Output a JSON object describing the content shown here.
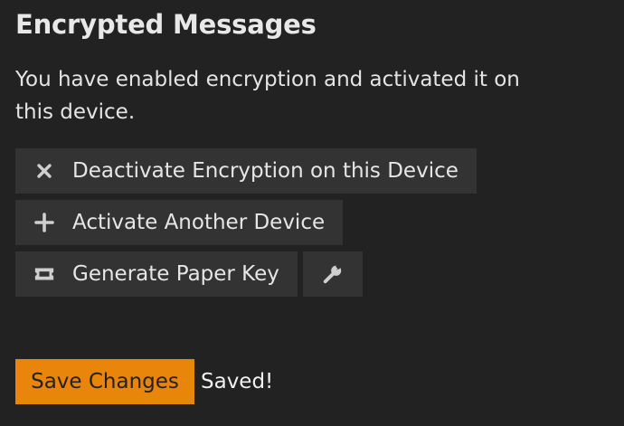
{
  "section": {
    "title": "Encrypted Messages",
    "description": "You have enabled encryption and activated it on this device."
  },
  "actions": {
    "deactivate": {
      "label": "Deactivate Encryption on this Device",
      "icon": "close-icon"
    },
    "activate_another": {
      "label": "Activate Another Device",
      "icon": "plus-icon"
    },
    "paper_key": {
      "label": "Generate Paper Key",
      "icon": "ticket-icon"
    },
    "settings": {
      "icon": "wrench-icon"
    }
  },
  "footer": {
    "save_label": "Save Changes",
    "status": "Saved!"
  },
  "colors": {
    "background": "#222222",
    "button_background": "#333333",
    "accent": "#e8850a"
  }
}
